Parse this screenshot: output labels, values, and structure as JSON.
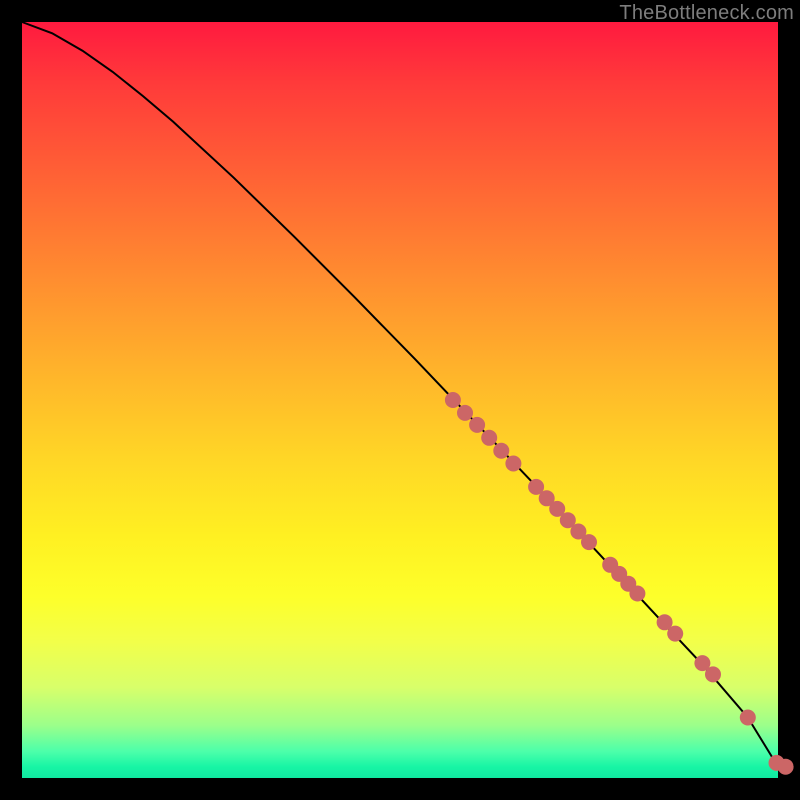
{
  "attribution": "TheBottleneck.com",
  "chart_data": {
    "type": "line",
    "title": "",
    "xlabel": "",
    "ylabel": "",
    "xlim": [
      0,
      1
    ],
    "ylim": [
      0,
      1
    ],
    "background_gradient": {
      "direction": "vertical",
      "stops": [
        {
          "pos": 0.0,
          "color": "#ff1a3f"
        },
        {
          "pos": 0.5,
          "color": "#ffcf26"
        },
        {
          "pos": 0.8,
          "color": "#f8ff30"
        },
        {
          "pos": 1.0,
          "color": "#10e8a0"
        }
      ]
    },
    "series": [
      {
        "name": "curve",
        "color": "#000000",
        "stroke_width": 2,
        "x": [
          0.0,
          0.04,
          0.08,
          0.12,
          0.16,
          0.2,
          0.28,
          0.36,
          0.44,
          0.52,
          0.6,
          0.68,
          0.76,
          0.84,
          0.9,
          0.96,
          1.0
        ],
        "y": [
          1.0,
          0.985,
          0.962,
          0.934,
          0.902,
          0.868,
          0.794,
          0.716,
          0.636,
          0.554,
          0.47,
          0.386,
          0.3,
          0.214,
          0.15,
          0.08,
          0.015
        ]
      }
    ],
    "markers": [
      {
        "name": "cluster",
        "color": "#cc6666",
        "radius": 8,
        "points": [
          {
            "x": 0.57,
            "y": 0.5
          },
          {
            "x": 0.586,
            "y": 0.483
          },
          {
            "x": 0.602,
            "y": 0.467
          },
          {
            "x": 0.618,
            "y": 0.45
          },
          {
            "x": 0.634,
            "y": 0.433
          },
          {
            "x": 0.65,
            "y": 0.416
          },
          {
            "x": 0.68,
            "y": 0.385
          },
          {
            "x": 0.694,
            "y": 0.37
          },
          {
            "x": 0.708,
            "y": 0.356
          },
          {
            "x": 0.722,
            "y": 0.341
          },
          {
            "x": 0.736,
            "y": 0.326
          },
          {
            "x": 0.75,
            "y": 0.312
          },
          {
            "x": 0.778,
            "y": 0.282
          },
          {
            "x": 0.79,
            "y": 0.27
          },
          {
            "x": 0.802,
            "y": 0.257
          },
          {
            "x": 0.814,
            "y": 0.244
          },
          {
            "x": 0.85,
            "y": 0.206
          },
          {
            "x": 0.864,
            "y": 0.191
          },
          {
            "x": 0.9,
            "y": 0.152
          },
          {
            "x": 0.914,
            "y": 0.137
          },
          {
            "x": 0.96,
            "y": 0.08
          },
          {
            "x": 0.998,
            "y": 0.02
          },
          {
            "x": 1.01,
            "y": 0.015
          }
        ]
      }
    ]
  }
}
